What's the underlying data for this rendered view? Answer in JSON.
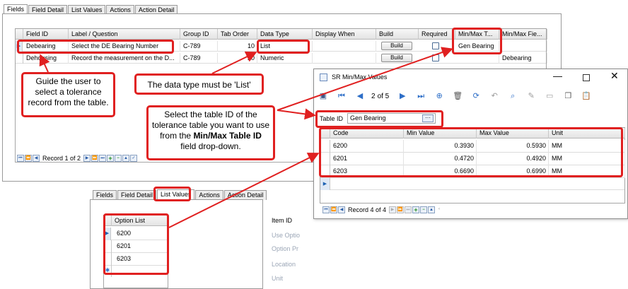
{
  "main": {
    "tabs": [
      "Fields",
      "Field Detail",
      "List Values",
      "Actions",
      "Action Detail"
    ],
    "columns": [
      "Field ID",
      "Label / Question",
      "Group ID",
      "Tab Order",
      "Data Type",
      "Display When",
      "Build",
      "Required",
      "Min/Max T...",
      "Min/Max Fie..."
    ],
    "rows": [
      {
        "field_id": "Debearing",
        "label": "Select the DE Bearing Number",
        "group": "C-789",
        "tab_order": "10",
        "data_type": "List",
        "display_when": "",
        "build": "Build",
        "minmax_t": "Gen Bearing",
        "minmax_f": ""
      },
      {
        "field_id": "Dehousing",
        "label": "Record the measurement on the D...",
        "group": "C-789",
        "tab_order": "20",
        "data_type": "Numeric",
        "display_when": "",
        "build": "Build",
        "minmax_t": "",
        "minmax_f": "Debearing"
      }
    ],
    "record_text": "Record 1 of 2"
  },
  "callouts": {
    "guide": "Guide the user to select a tolerance record from the table.",
    "datatype": "The data type must be 'List'",
    "tableid_pre": "Select the table ID of the tolerance table you want to use from the ",
    "tableid_bold": "Min/Max Table ID",
    "tableid_post": " field drop-down."
  },
  "popup": {
    "title": "SR Min/Max Values",
    "page_current": "2",
    "page_total": "of 5",
    "table_id_label": "Table ID",
    "table_id_value": "Gen Bearing",
    "columns": [
      "Code",
      "Min Value",
      "Max Value",
      "Unit"
    ],
    "rows": [
      {
        "code": "6200",
        "min": "0.3930",
        "max": "0.5930",
        "unit": "MM"
      },
      {
        "code": "6201",
        "min": "0.4720",
        "max": "0.4920",
        "unit": "MM"
      },
      {
        "code": "6203",
        "min": "0.6690",
        "max": "0.6990",
        "unit": "MM"
      }
    ],
    "record_text": "Record 4 of 4"
  },
  "list_values": {
    "tabs": [
      "Fields",
      "Field Detail",
      "List Values",
      "Actions",
      "Action Detail"
    ],
    "column": "Option List",
    "options": [
      "6200",
      "6201",
      "6203"
    ],
    "side_labels": [
      "Item ID",
      "Use Optio",
      "Option Pr",
      "Location",
      "Unit"
    ]
  },
  "colors": {
    "annotation_red": "#e02020",
    "accent_blue": "#2e6fc8"
  }
}
